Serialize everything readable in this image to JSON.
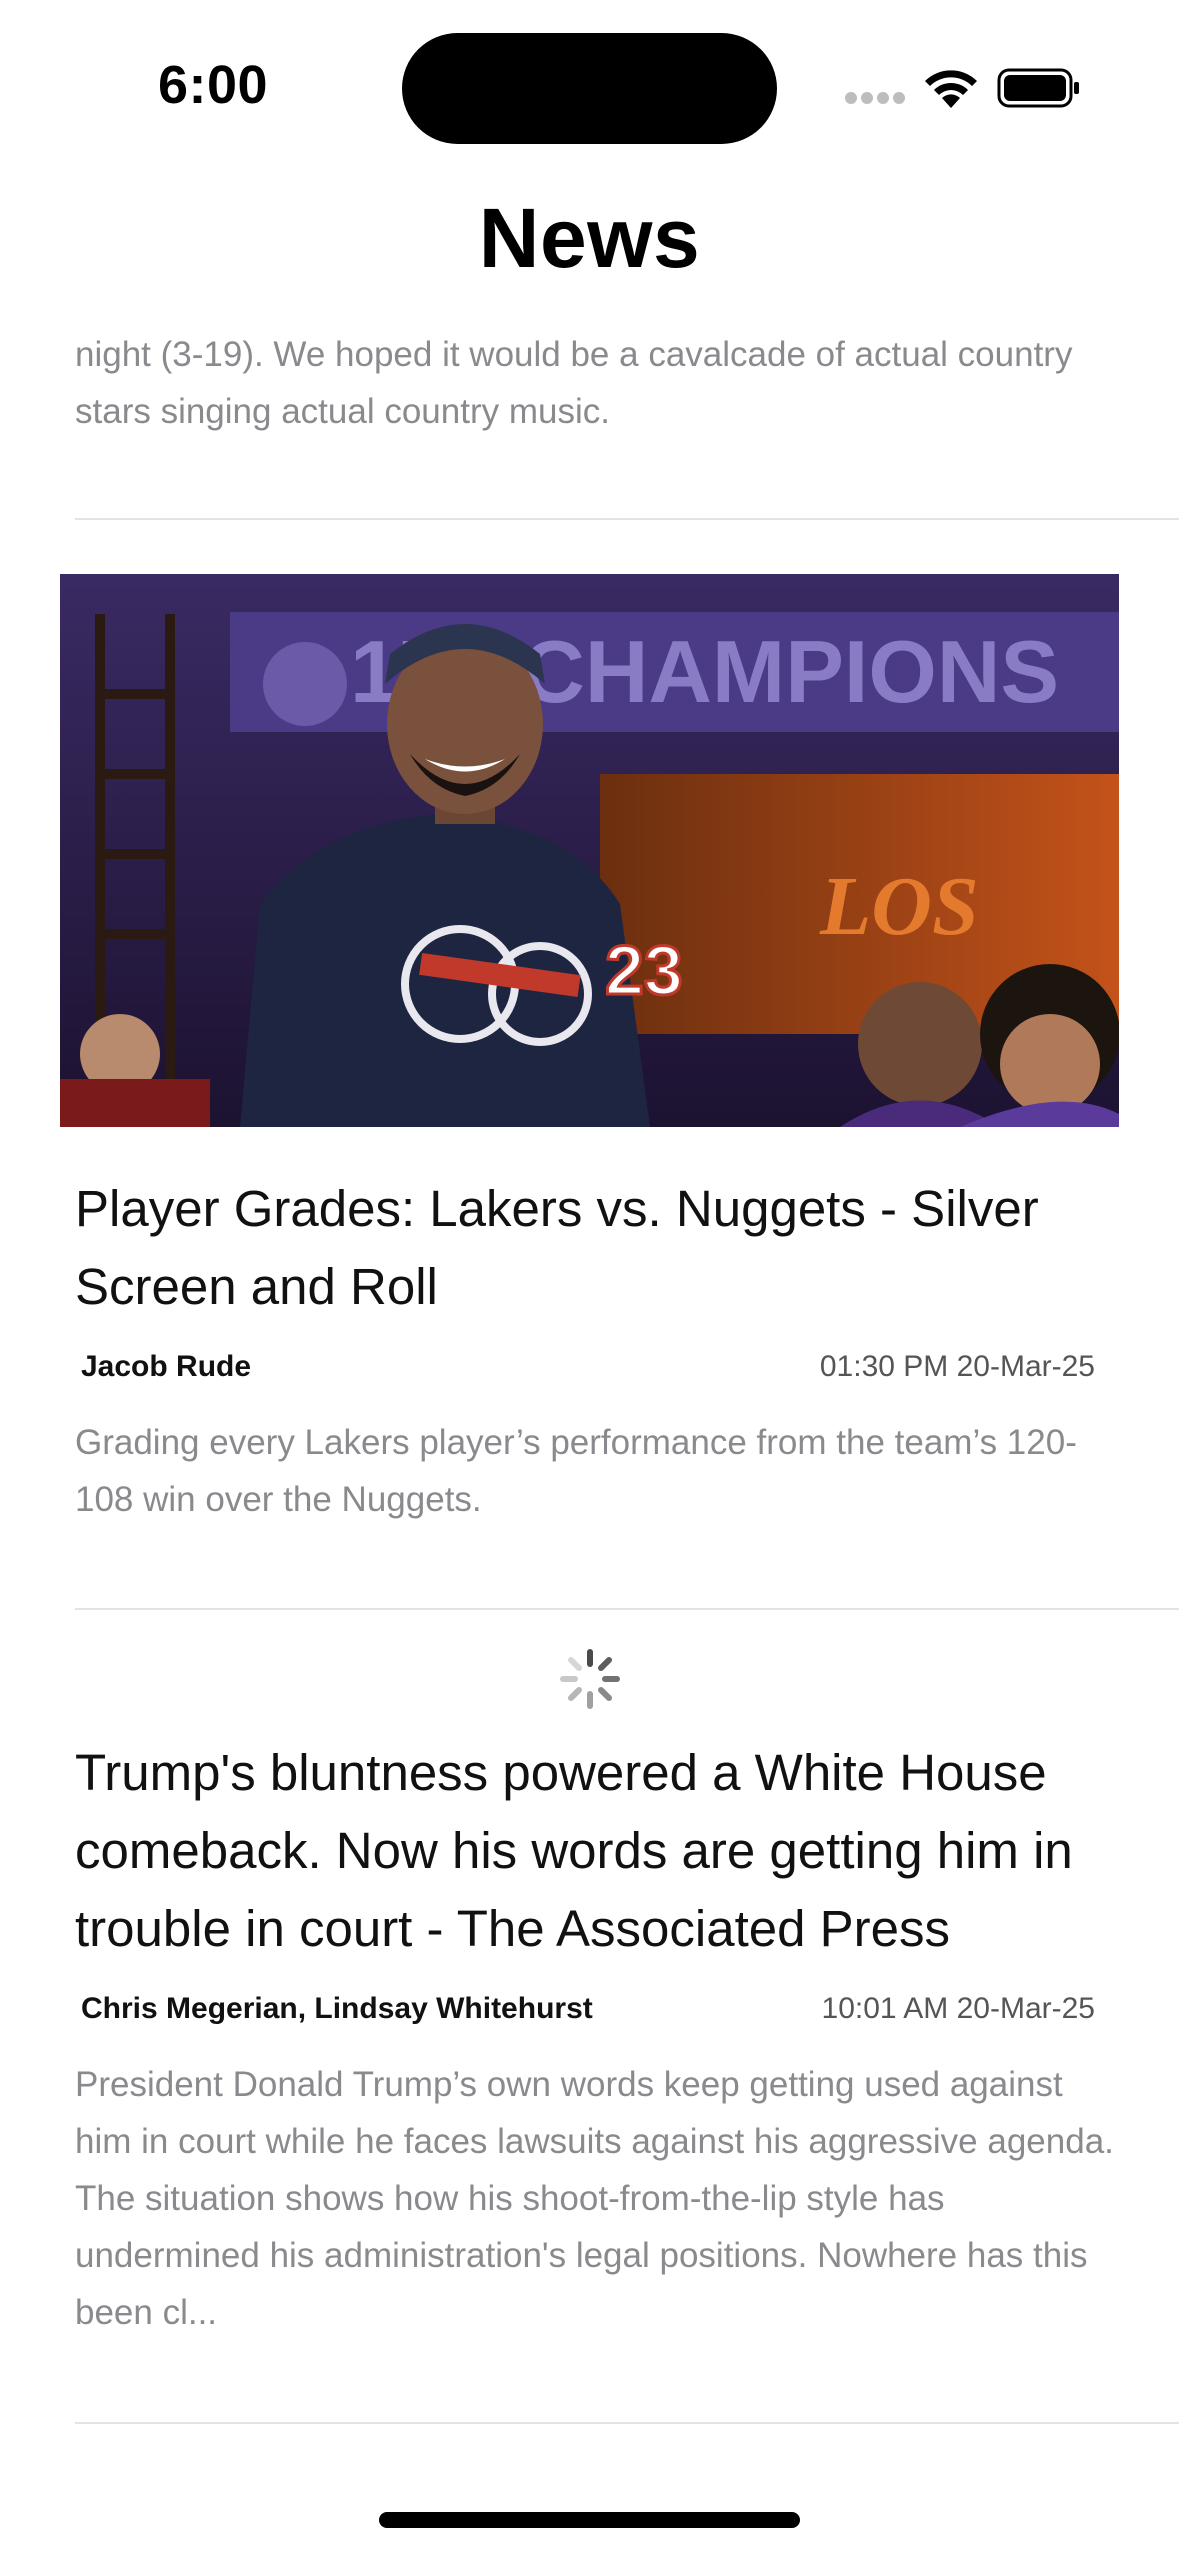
{
  "status_bar": {
    "time": "6:00"
  },
  "header": {
    "title": "News"
  },
  "articles": [
    {
      "summary": "night (3-19). We hoped it would be a cavalcade of actual country stars singing actual country music."
    },
    {
      "image_description": "Player in navy cannon jersey in front of 17x CHAMPIONS banner",
      "image_text": {
        "banner": "17x CHAMPIONS",
        "sign": "LOS",
        "jersey_number": "23"
      },
      "headline": "Player Grades: Lakers vs. Nuggets - Silver Screen and Roll",
      "author": "Jacob Rude",
      "timestamp": "01:30 PM 20-Mar-25",
      "summary": "Grading every Lakers player’s performance from the team’s 120-108 win over the Nuggets."
    },
    {
      "headline": "Trump's bluntness powered a White House comeback. Now his words are getting him in trouble in court - The Associated Press",
      "author": "Chris Megerian, Lindsay Whitehurst",
      "timestamp": "10:01 AM 20-Mar-25",
      "summary": "President Donald Trump’s own words keep getting used against him in court while he faces lawsuits against his aggressive agenda. The situation shows how his shoot-from-the-lip style has undermined his administration's legal positions. Nowhere has this been cl..."
    }
  ],
  "icons": {
    "spinner": "loading-spinner-icon",
    "wifi": "wifi-icon",
    "battery": "battery-icon",
    "signal": "cellular-signal-icon"
  }
}
